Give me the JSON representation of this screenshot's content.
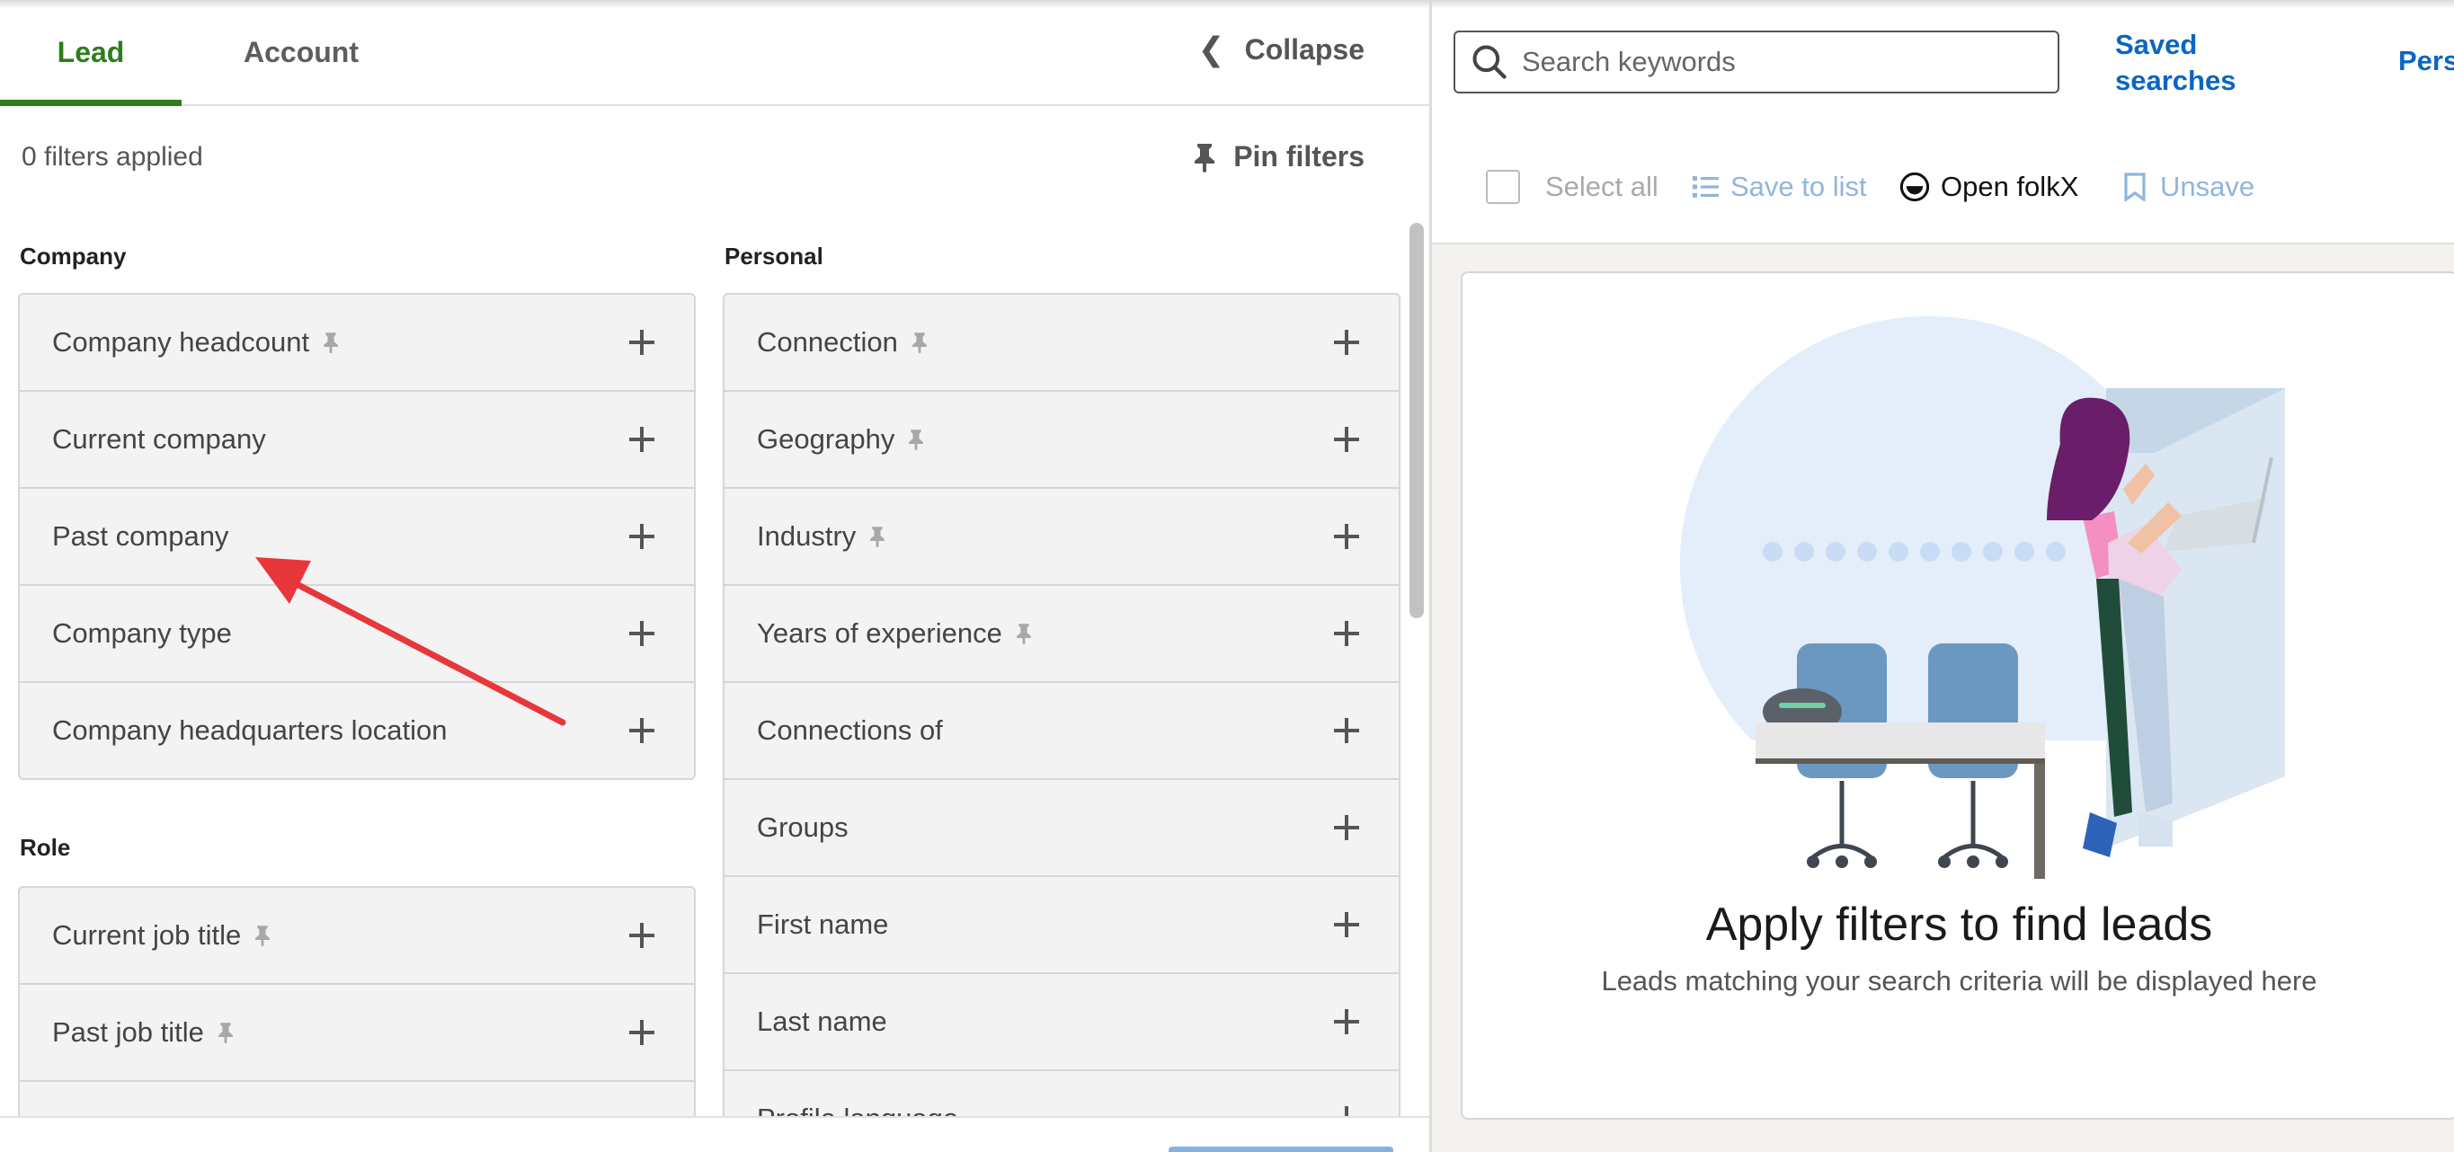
{
  "tabs": [
    {
      "label": "Lead",
      "active": true
    },
    {
      "label": "Account",
      "active": false
    }
  ],
  "collapse_label": "Collapse",
  "filters_applied": "0 filters applied",
  "pin_filters_label": "Pin filters",
  "sections": {
    "company": {
      "title": "Company",
      "items": [
        {
          "label": "Company headcount",
          "pinned": true
        },
        {
          "label": "Current company",
          "pinned": false
        },
        {
          "label": "Past company",
          "pinned": false
        },
        {
          "label": "Company type",
          "pinned": false
        },
        {
          "label": "Company headquarters location",
          "pinned": false
        }
      ]
    },
    "role": {
      "title": "Role",
      "items": [
        {
          "label": "Current job title",
          "pinned": true
        },
        {
          "label": "Past job title",
          "pinned": true
        },
        {
          "label": "",
          "pinned": false
        }
      ]
    },
    "personal": {
      "title": "Personal",
      "items": [
        {
          "label": "Connection",
          "pinned": true
        },
        {
          "label": "Geography",
          "pinned": true
        },
        {
          "label": "Industry",
          "pinned": true
        },
        {
          "label": "Years of experience",
          "pinned": true
        },
        {
          "label": "Connections of",
          "pinned": false
        },
        {
          "label": "Groups",
          "pinned": false
        },
        {
          "label": "First name",
          "pinned": false
        },
        {
          "label": "Last name",
          "pinned": false
        },
        {
          "label": "Profile language",
          "pinned": false
        }
      ]
    }
  },
  "search": {
    "placeholder": "Search keywords",
    "value": ""
  },
  "saved_searches_label": "Saved searches",
  "pers_label": "Pers",
  "toolbar": {
    "select_all": "Select all",
    "save_to_list": "Save to list",
    "open_folkx": "Open folkX",
    "unsave": "Unsave"
  },
  "empty_state": {
    "title": "Apply filters to find leads",
    "subtitle": "Leads matching your search criteria will be displayed here"
  },
  "colors": {
    "accent_green": "#2f7d1e",
    "link_blue": "#0a66c2",
    "annotation_red": "#e8373a"
  }
}
